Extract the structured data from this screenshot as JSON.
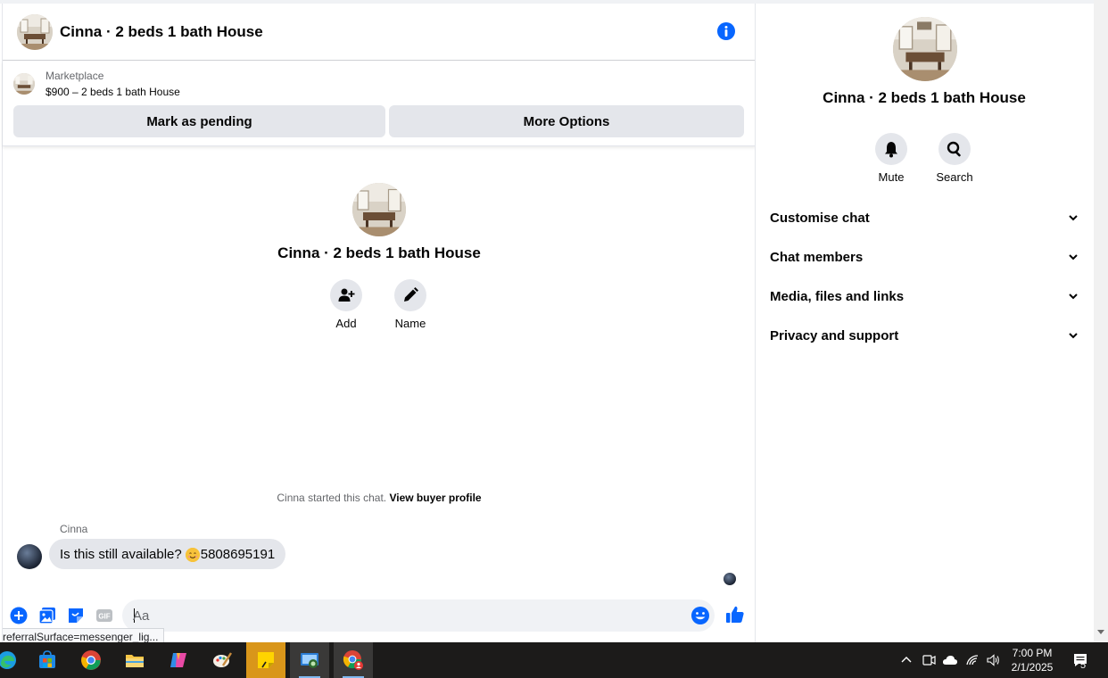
{
  "chat": {
    "title": "Cinna · 2 beds 1 bath House",
    "marketplace_label": "Marketplace",
    "listing_title": "$900 – 2 beds 1 bath House",
    "mark_pending_label": "Mark as pending",
    "more_options_label": "More Options",
    "center_title": "Cinna · 2 beds 1 bath House",
    "add_label": "Add",
    "name_label": "Name",
    "started_text": "Cinna started this chat.",
    "view_profile_label": "View buyer profile",
    "sender": "Cinna",
    "message_text": "Is this still available?",
    "message_number": "5808695191",
    "composer_placeholder": "Aa",
    "status_url": "referralSurface=messenger_lig..."
  },
  "panel": {
    "title": "Cinna · 2 beds 1 bath House",
    "mute_label": "Mute",
    "search_label": "Search",
    "sections": [
      {
        "label": "Customise chat"
      },
      {
        "label": "Chat members"
      },
      {
        "label": "Media, files and links"
      },
      {
        "label": "Privacy and support"
      }
    ]
  },
  "taskbar": {
    "apps": [
      "edge-icon",
      "microsoft-store-icon",
      "chrome-icon",
      "file-explorer-icon",
      "copilot-icon",
      "paint-icon",
      "sticky-notes-icon",
      "remote-desktop-icon",
      "chrome-profile-icon"
    ],
    "time": "7:00 PM",
    "date": "2/1/2025",
    "notification_count": "5"
  },
  "colors": {
    "accent": "#0866ff",
    "button_gray": "#e4e6eb",
    "taskbar": "#1c1b1a"
  }
}
